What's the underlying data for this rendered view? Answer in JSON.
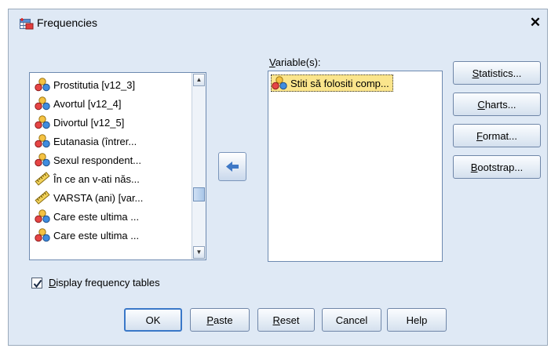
{
  "window": {
    "title": "Frequencies",
    "close_glyph": "✕"
  },
  "left_list": {
    "items": [
      {
        "label": "Prostitutia [v12_3]",
        "icon": "nominal-icon"
      },
      {
        "label": "Avortul [v12_4]",
        "icon": "nominal-icon"
      },
      {
        "label": "Divortul [v12_5]",
        "icon": "nominal-icon"
      },
      {
        "label": "Eutanasia (întrer...",
        "icon": "nominal-icon"
      },
      {
        "label": "Sexul respondent...",
        "icon": "nominal-icon"
      },
      {
        "label": "În ce an v-ati năs...",
        "icon": "scale-icon"
      },
      {
        "label": "VARSTA (ani) [var...",
        "icon": "scale-icon"
      },
      {
        "label": "Care este ultima ...",
        "icon": "nominal-icon"
      },
      {
        "label": "Care este ultima ...",
        "icon": "nominal-icon"
      }
    ]
  },
  "variables": {
    "label_pre": "",
    "label_accel": "V",
    "label_post": "ariable(s):",
    "items": [
      {
        "label": "Stiti să folositi comp...",
        "icon": "nominal-icon"
      }
    ]
  },
  "side_buttons": [
    {
      "pre": "",
      "accel": "S",
      "post": "tatistics..."
    },
    {
      "pre": "",
      "accel": "C",
      "post": "harts..."
    },
    {
      "pre": "",
      "accel": "F",
      "post": "ormat..."
    },
    {
      "pre": "",
      "accel": "B",
      "post": "ootstrap..."
    }
  ],
  "checkbox": {
    "pre": "",
    "accel": "D",
    "post": "isplay frequency tables",
    "checked": true
  },
  "bottom_buttons": {
    "ok": {
      "label": "OK"
    },
    "paste": {
      "pre": "",
      "accel": "P",
      "post": "aste"
    },
    "reset": {
      "pre": "",
      "accel": "R",
      "post": "eset"
    },
    "cancel": {
      "label": "Cancel"
    },
    "help": {
      "label": "Help"
    }
  },
  "colors": {
    "dialog_bg": "#dfe9f5",
    "selection": "#fbe58c",
    "accent": "#3a78c8"
  }
}
